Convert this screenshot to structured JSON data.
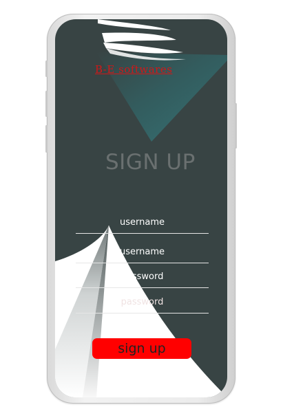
{
  "app": {
    "brand": "B-E softwares"
  },
  "page": {
    "title": "SIGN UP"
  },
  "form": {
    "fields": [
      {
        "placeholder": "username",
        "value": ""
      },
      {
        "placeholder": "username",
        "value": ""
      },
      {
        "placeholder": "password",
        "value": ""
      },
      {
        "placeholder": "password",
        "value": ""
      }
    ],
    "submit_label": "sign up"
  },
  "colors": {
    "screen_background": "#384444",
    "accent_teal": "#2f6f72",
    "brand_text": "#d01818",
    "button_background": "#ff0000",
    "field_underline": "#e6e6e6"
  }
}
